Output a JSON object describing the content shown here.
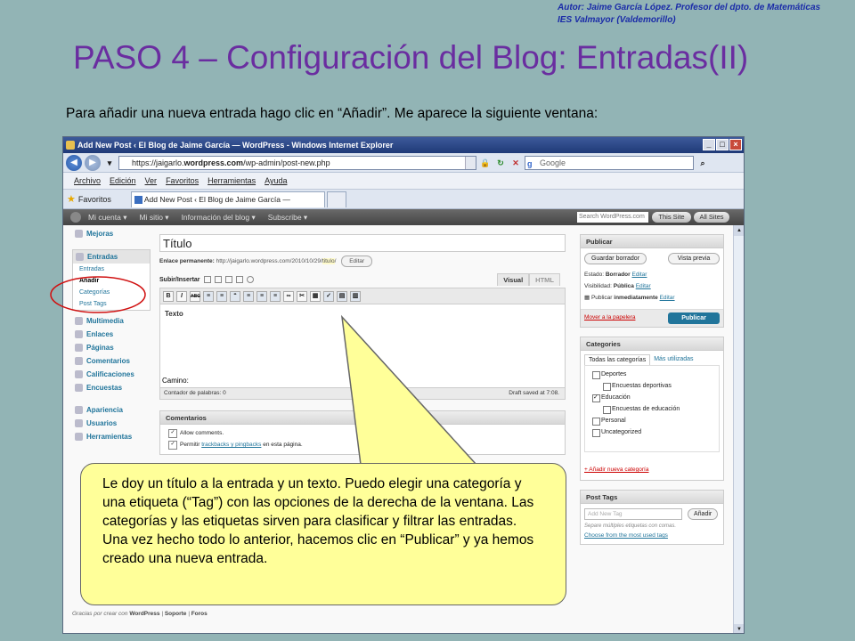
{
  "slide": {
    "author_line1": "Autor: Jaime García López. Profesor del dpto. de Matemáticas",
    "author_line2": "IES Valmayor (Valdemorillo)",
    "title": "PASO 4 – Configuración del Blog: Entradas(II)",
    "intro": "Para añadir una nueva entrada hago clic en “Añadir”. Me aparece la siguiente ventana:",
    "callout": "Le doy un título a la entrada y un texto. Puedo elegir una categoría y una etiqueta (“Tag”) con las opciones de la derecha de la ventana. Las categorías y las etiquetas sirven para clasificar y filtrar las entradas. Una vez hecho todo lo anterior, hacemos clic en “Publicar” y ya hemos creado una nueva entrada."
  },
  "browser": {
    "window_title": "Add New Post ‹ El Blog de Jaime García — WordPress - Windows Internet Explorer",
    "url_prefix": "https://jaigarlo.",
    "url_domain": "wordpress.com",
    "url_suffix": "/wp-admin/post-new.php",
    "search_placeholder": "Google",
    "menu": [
      "Archivo",
      "Edición",
      "Ver",
      "Favoritos",
      "Herramientas",
      "Ayuda"
    ],
    "favorites_label": "Favoritos",
    "tab_label": "Add New Post ‹ El Blog de Jaime García — WordPress"
  },
  "adminbar": {
    "items": [
      "Mi cuenta ▾",
      "Mi sitio ▾",
      "Información del blog ▾",
      "Subscribe ▾"
    ],
    "search_placeholder": "Search WordPress.com",
    "this_site": "This Site",
    "all_sites": "All Sites"
  },
  "sidebar": {
    "mejoras": "Mejoras",
    "entradas": "Entradas",
    "sub": [
      "Entradas",
      "Añadir",
      "Categorías",
      "Post Tags"
    ],
    "items": [
      "Multimedia",
      "Enlaces",
      "Páginas",
      "Comentarios",
      "Calificaciones",
      "Encuestas"
    ],
    "items2": [
      "Apariencia",
      "Usuarios",
      "Herramientas"
    ]
  },
  "editor": {
    "title_value": "Título",
    "permalink_label": "Enlace permanente:",
    "permalink_url": "http://jaigarlo.wordpress.com/2010/10/29/",
    "permalink_slug": "titulo",
    "permalink_edit": "Editar",
    "upload_label": "Subir/Insertar",
    "tab_visual": "Visual",
    "tab_html": "HTML",
    "toolbar": [
      "B",
      "I",
      "ABC",
      "≡",
      "≡",
      "“",
      "≡",
      "≡",
      "≡",
      "∞",
      "✂",
      "▦",
      "✓",
      "▤",
      "▥"
    ],
    "body_text": "Texto",
    "path_label": "Camino:",
    "word_count": "Contador de palabras: 0",
    "draft_saved": "Draft saved at 7:08."
  },
  "comments": {
    "header": "Comentarios",
    "allow": "Allow comments.",
    "trackbacks_pre": "Permitir ",
    "trackbacks_link": "trackbacks y pingbacks",
    "trackbacks_post": " en esta página."
  },
  "publish": {
    "header": "Publicar",
    "save_draft": "Guardar borrador",
    "preview": "Vista previa",
    "status_label": "Estado:",
    "status_value": "Borrador",
    "visibility_label": "Visibilidad:",
    "visibility_value": "Pública",
    "publish_when_pre": "Publicar",
    "publish_when_value": "inmediatamente",
    "edit": "Editar",
    "trash": "Mover a la papelera",
    "publish_button": "Publicar"
  },
  "categories": {
    "header": "Categories",
    "tab_all": "Todas las categorías",
    "tab_used": "Más utilizadas",
    "items": [
      {
        "label": "Deportes",
        "checked": false,
        "sub": false
      },
      {
        "label": "Encuestas deportivas",
        "checked": false,
        "sub": true
      },
      {
        "label": "Educación",
        "checked": true,
        "sub": false
      },
      {
        "label": "Encuestas de educación",
        "checked": false,
        "sub": true
      },
      {
        "label": "Personal",
        "checked": false,
        "sub": false
      },
      {
        "label": "Uncategorized",
        "checked": false,
        "sub": false
      }
    ],
    "add_new": "+ Añadir nueva categoría"
  },
  "tags": {
    "header": "Post Tags",
    "placeholder": "Add New Tag",
    "add_button": "Añadir",
    "note": "Separe múltiples etiquetas con comas.",
    "choose": "Choose from the most used tags"
  },
  "footer": {
    "pre": "Gracias por crear con ",
    "wp": "WordPress",
    "support": "Soporte",
    "forums": "Foros",
    "sep": " | "
  }
}
